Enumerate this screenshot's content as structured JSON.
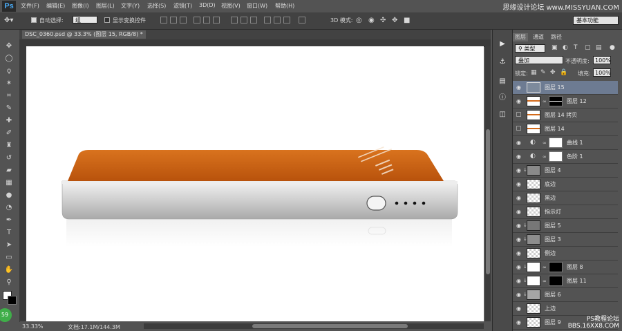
{
  "app": {
    "logo": "Ps"
  },
  "menu": [
    "文件(F)",
    "编辑(E)",
    "图像(I)",
    "图层(L)",
    "文字(Y)",
    "选择(S)",
    "滤镜(T)",
    "3D(D)",
    "视图(V)",
    "窗口(W)",
    "帮助(H)"
  ],
  "watermark_top": "思缘设计论坛 www.MISSYUAN.COM",
  "options_bar": {
    "auto_select_label": "自动选择:",
    "auto_select_value": "组",
    "show_transform_label": "显示变换控件",
    "mode_3d_label": "3D 模式:",
    "workspace": "基本功能"
  },
  "document": {
    "tab_label": "DSC_0360.psd @ 33.3% (图层 15, RGB/8) *",
    "zoom": "33.33%",
    "doc_size": "文档:17.1M/144.3M"
  },
  "layers_panel": {
    "tabs": [
      "图层",
      "通道",
      "路径"
    ],
    "filter_label": "类型",
    "blend_mode": "叠加",
    "opacity_label": "不透明度:",
    "opacity_value": "100%",
    "lock_label": "锁定:",
    "fill_label": "填充:",
    "fill_value": "100%",
    "layers": [
      {
        "name": "图层 15",
        "visible": true,
        "selected": true
      },
      {
        "name": "图层 12",
        "visible": true,
        "selected": false
      },
      {
        "name": "图层 14 拷贝",
        "visible": false,
        "selected": false
      },
      {
        "name": "图层 14",
        "visible": false,
        "selected": false
      },
      {
        "name": "曲线 1",
        "visible": true,
        "selected": false
      },
      {
        "name": "色阶 1",
        "visible": true,
        "selected": false
      },
      {
        "name": "图层 4",
        "visible": true,
        "selected": false
      },
      {
        "name": "底边",
        "visible": true,
        "selected": false
      },
      {
        "name": "黑边",
        "visible": true,
        "selected": false
      },
      {
        "name": "指示灯",
        "visible": true,
        "selected": false
      },
      {
        "name": "图层 5",
        "visible": true,
        "selected": false
      },
      {
        "name": "图层 3",
        "visible": true,
        "selected": false
      },
      {
        "name": "侧边",
        "visible": true,
        "selected": false
      },
      {
        "name": "图层 8",
        "visible": true,
        "selected": false
      },
      {
        "name": "图层 11",
        "visible": true,
        "selected": false
      },
      {
        "name": "图层 6",
        "visible": true,
        "selected": false
      },
      {
        "name": "上边",
        "visible": true,
        "selected": false
      },
      {
        "name": "图层 9",
        "visible": true,
        "selected": false
      }
    ]
  },
  "badge": "59",
  "watermark_bottom": [
    "PS教程论坛",
    "BBS.16XX8.COM"
  ]
}
